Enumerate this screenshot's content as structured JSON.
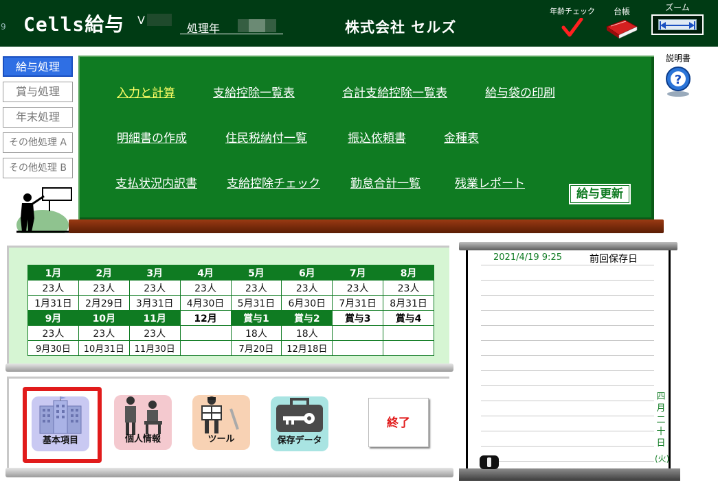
{
  "header": {
    "corner_number": "9",
    "app_title": "Cells給与",
    "version_prefix": "V",
    "year_label": "処理年",
    "company": "株式会社 セルズ",
    "age_check_label": "年齢チェック",
    "ledger_label": "台帳",
    "zoom_label": "ズーム"
  },
  "help": {
    "label": "説明書"
  },
  "side_menu": [
    {
      "label": "給与処理",
      "active": true
    },
    {
      "label": "賞与処理",
      "active": false
    },
    {
      "label": "年末処理",
      "active": false
    },
    {
      "label": "その他処理 A",
      "active": false
    },
    {
      "label": "その他処理 B",
      "active": false
    }
  ],
  "board": {
    "links": [
      "入力と計算",
      "支給控除一覧表",
      "合計支給控除一覧表",
      "給与袋の印刷",
      "明細書の作成",
      "住民税納付一覧",
      "振込依頼書",
      "金種表",
      "支払状況内訳書",
      "支給控除チェック",
      "勤怠合計一覧",
      "残業レポート"
    ],
    "update_button": "給与更新"
  },
  "calendar": {
    "row1": {
      "months": [
        "1月",
        "2月",
        "3月",
        "4月",
        "5月",
        "6月",
        "7月",
        "8月"
      ],
      "counts": [
        "23人",
        "23人",
        "23人",
        "23人",
        "23人",
        "23人",
        "23人",
        "23人"
      ],
      "dates": [
        "1月31日",
        "2月29日",
        "3月31日",
        "4月30日",
        "5月31日",
        "6月30日",
        "7月31日",
        "8月31日"
      ]
    },
    "row2": {
      "months": [
        "9月",
        "10月",
        "11月",
        "12月",
        "賞与1",
        "賞与2",
        "賞与3",
        "賞与4"
      ],
      "counts": [
        "23人",
        "23人",
        "23人",
        "",
        "18人",
        "18人",
        "",
        ""
      ],
      "dates": [
        "9月30日",
        "10月31日",
        "11月30日",
        "",
        "7月20日",
        "12月18日",
        "",
        ""
      ]
    }
  },
  "bottom_icons": {
    "basic": "基本項目",
    "personal": "個人情報",
    "tools": "ツール",
    "save_data": "保存データ",
    "end": "終了"
  },
  "note": {
    "saved_datetime": "2021/4/19 9:25",
    "saved_label": "前回保存日",
    "vertical_date": [
      "四",
      "月",
      "二",
      "十",
      "日"
    ],
    "weekday": "(火)"
  }
}
